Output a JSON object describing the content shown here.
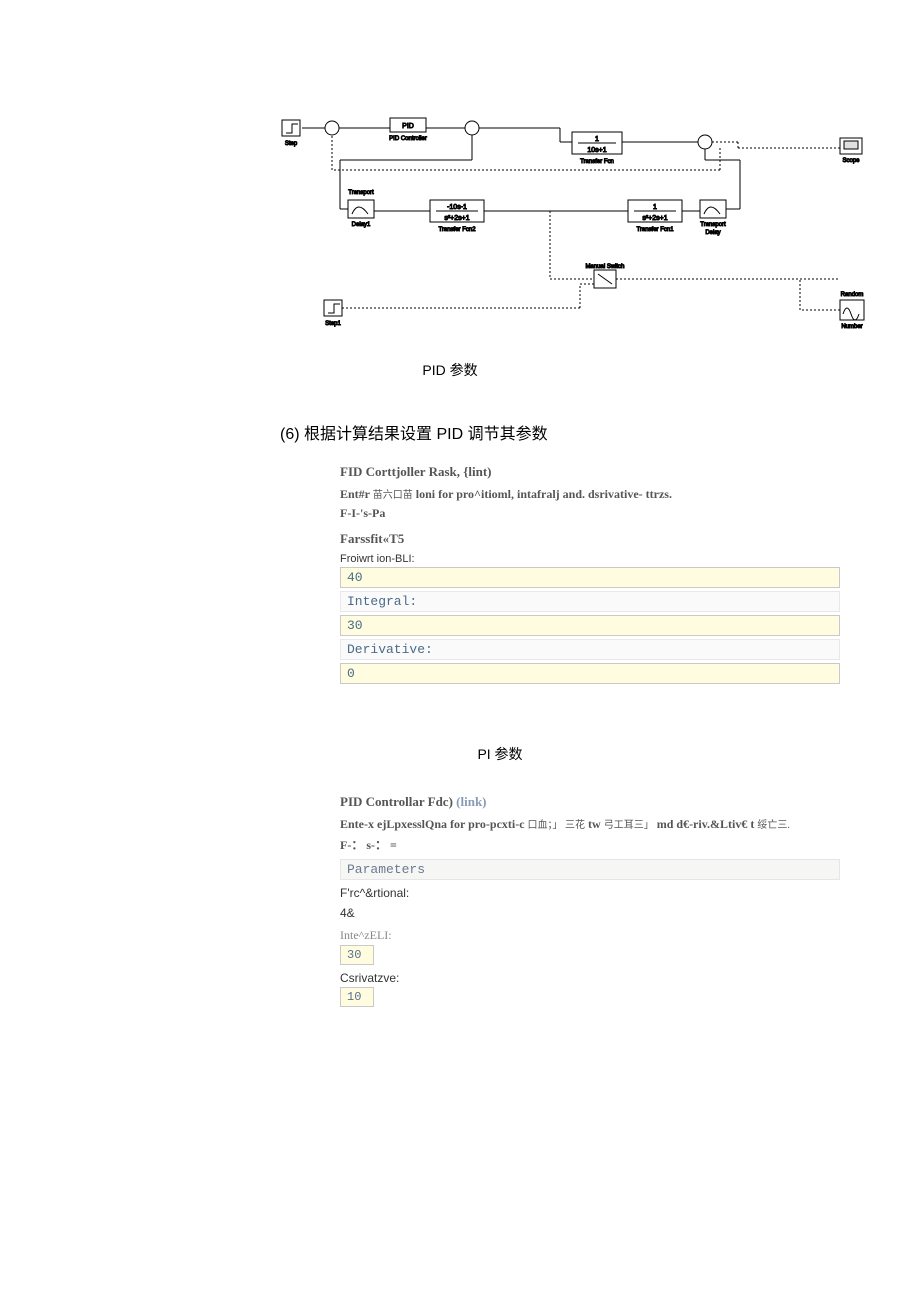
{
  "diagram": {
    "blocks": {
      "step": "Step",
      "pid_txt": "PID",
      "pid_controller": "PID Controller",
      "tf1_num": "1",
      "tf1_den": "10s+1",
      "tf1_name": "Transfer Fcn",
      "scope": "Scope",
      "td1_name": "Transport",
      "td1_name2": "Delay1",
      "tf2_num": "-10s-1",
      "tf2_den": "s²+2s+1",
      "tf2_name": "Transfer Fcn2",
      "tf3_num": "1",
      "tf3_den": "s²+2s+1",
      "tf3_name": "Transfer Fcn1",
      "td2_name": "Transport",
      "td2_name2": "Delay",
      "manual_switch": "Manual Switch",
      "step1": "Step1",
      "random": "Random",
      "number": "Number"
    },
    "caption": "PID 参数"
  },
  "heading6": "(6)   根据计算结果设置 PID 调节其参数",
  "dialog1": {
    "title": "FID Corttjoller Rask, {lint)",
    "desc_prefix": "Ent#r ",
    "desc_cjk": "苗六口苗",
    "desc_rest": " loni for pro^itioml, intafralj and. dsrivative- ttrzs.",
    "extra_line": "F-I-'s-Pa",
    "section": "Farssfit«T5",
    "p_label": "Froiwrt ion-BLI:",
    "p_value": "40",
    "i_label": "Integral:",
    "i_value": "30",
    "d_label": "Derivative:",
    "d_value": "0"
  },
  "pi_caption": "PI 参数",
  "dialog2": {
    "title_main": "PID Controllar Fdc) ",
    "title_link": "(link)",
    "desc_prefix": "Ente-x ejLpxesslQna for pro-pcxti-c ",
    "desc_cjk1": "口血；」 三花",
    "desc_mid": " tw ",
    "desc_cjk2": "弓工耳三」",
    "desc_rest": " md d€-riv.&Ltiv€ t ",
    "desc_cjk3": "绥亡三.",
    "extra_line": "F-：  s-：  =",
    "params_header": "Parameters",
    "p_label": "F'rc^&rtional:",
    "p_value": "4&",
    "i_label": "Inte^zELI:",
    "i_value": "30",
    "d_label": "Csrivatzve:",
    "d_value": "10"
  }
}
